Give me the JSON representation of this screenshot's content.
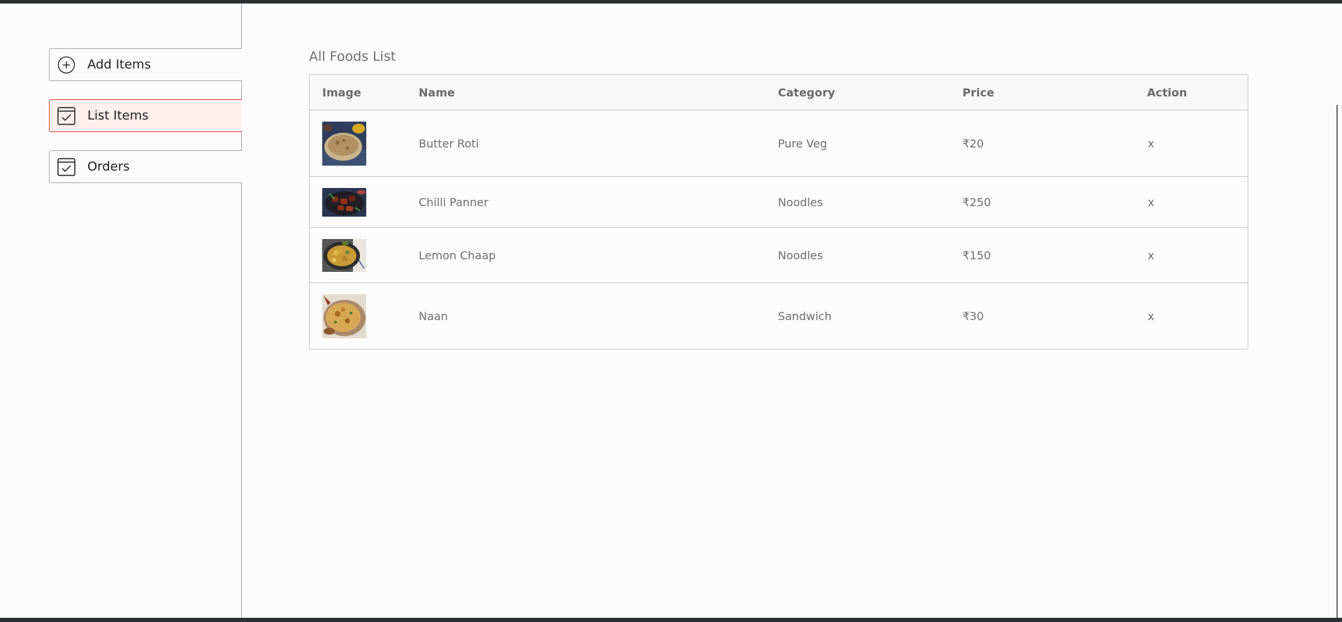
{
  "sidebar": {
    "items": [
      {
        "label": "Add Items",
        "icon": "plus-circle-icon"
      },
      {
        "label": "List Items",
        "icon": "checkbox-icon",
        "active": true
      },
      {
        "label": "Orders",
        "icon": "checkbox-icon"
      }
    ],
    "active_color": "#fff0ef",
    "active_border": "#d4443a"
  },
  "main": {
    "title": "All Foods List",
    "table": {
      "columns": [
        "Image",
        "Name",
        "Category",
        "Price",
        "Action"
      ],
      "rows": [
        {
          "image": "butter-roti-image",
          "name": "Butter Roti",
          "category": "Pure Veg",
          "price": "₹20",
          "action": "x"
        },
        {
          "image": "chilli-panner-image",
          "name": "Chilli Panner",
          "category": "Noodles",
          "price": "₹250",
          "action": "x"
        },
        {
          "image": "lemon-chaap-image",
          "name": "Lemon Chaap",
          "category": "Noodles",
          "price": "₹150",
          "action": "x"
        },
        {
          "image": "naan-image",
          "name": "Naan",
          "category": "Sandwich",
          "price": "₹30",
          "action": "x"
        }
      ]
    }
  }
}
